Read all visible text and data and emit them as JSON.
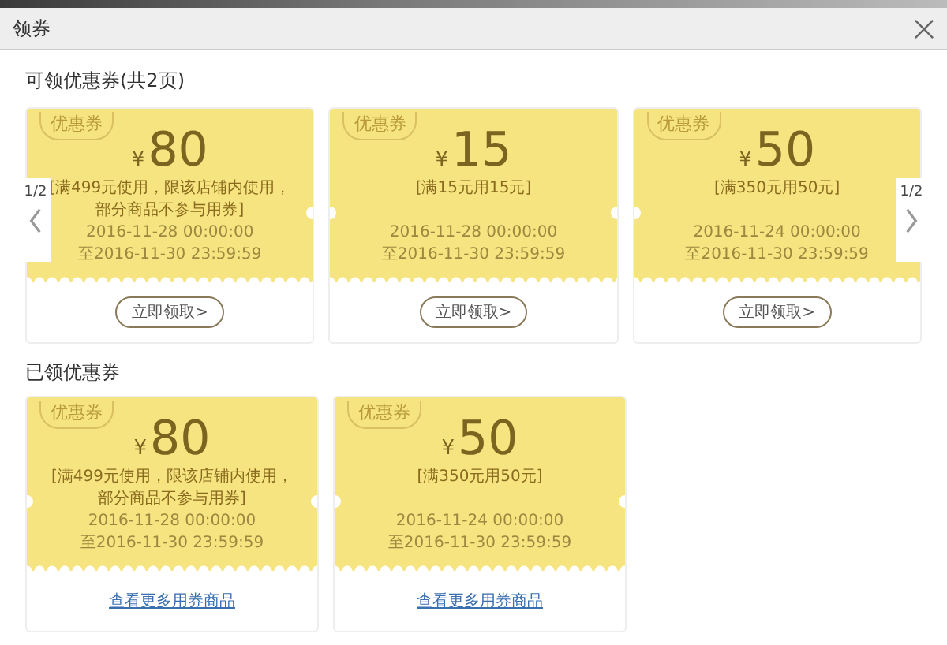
{
  "dialog": {
    "title": "领券",
    "available": {
      "heading": "可领优惠券(共2页)",
      "pagers": [
        {
          "kind": "prev",
          "page": "1/2"
        },
        {
          "kind": "next",
          "page": "1/2"
        }
      ],
      "coupons": [
        {
          "stamp": "优惠券",
          "currency": "¥",
          "amount": "80",
          "condition": "[满499元使用，限该店铺内使用，部分商品不参与用券]",
          "start": "2016-11-28 00:00:00",
          "end": "至2016-11-30 23:59:59",
          "action": {
            "kind": "button",
            "label": "立即领取>"
          }
        },
        {
          "stamp": "优惠券",
          "currency": "¥",
          "amount": "15",
          "condition": "[满15元用15元]",
          "start": "2016-11-28 00:00:00",
          "end": "至2016-11-30 23:59:59",
          "action": {
            "kind": "button",
            "label": "立即领取>"
          }
        },
        {
          "stamp": "优惠券",
          "currency": "¥",
          "amount": "50",
          "condition": "[满350元用50元]",
          "start": "2016-11-24 00:00:00",
          "end": "至2016-11-30 23:59:59",
          "action": {
            "kind": "button",
            "label": "立即领取>"
          }
        }
      ]
    },
    "claimed": {
      "heading": "已领优惠券",
      "coupons": [
        {
          "stamp": "优惠券",
          "currency": "¥",
          "amount": "80",
          "condition": "[满499元使用，限该店铺内使用，部分商品不参与用券]",
          "start": "2016-11-28 00:00:00",
          "end": "至2016-11-30 23:59:59",
          "action": {
            "kind": "link",
            "label": "查看更多用券商品"
          }
        },
        {
          "stamp": "优惠券",
          "currency": "¥",
          "amount": "50",
          "condition": "[满350元用50元]",
          "start": "2016-11-24 00:00:00",
          "end": "至2016-11-30 23:59:59",
          "action": {
            "kind": "link",
            "label": "查看更多用券商品"
          }
        }
      ]
    }
  }
}
